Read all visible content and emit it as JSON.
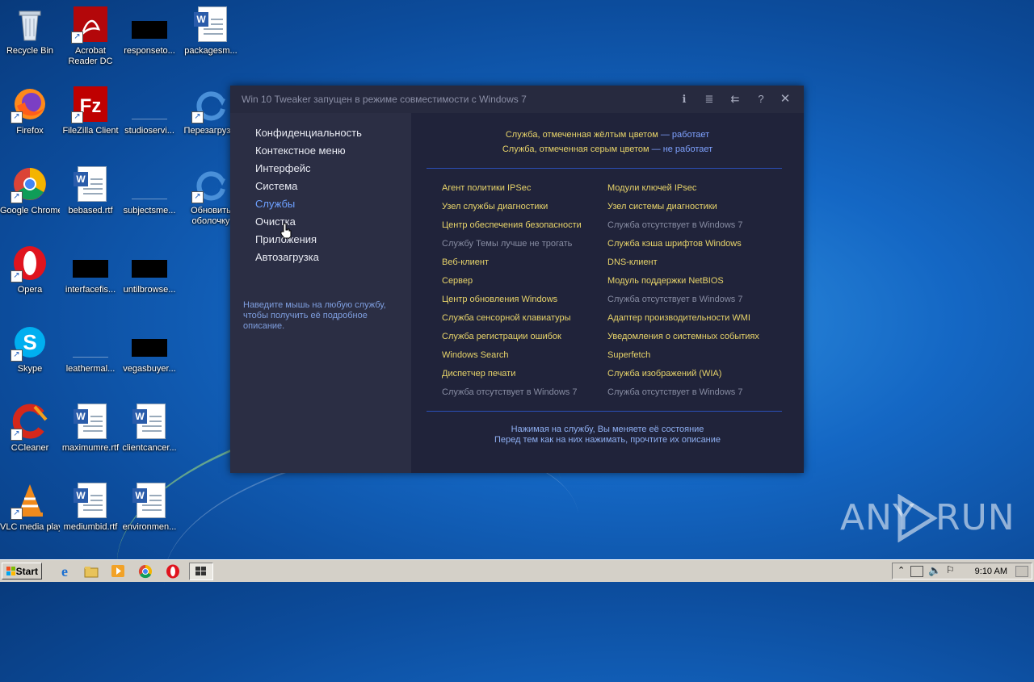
{
  "desktop": {
    "icons": [
      {
        "label": "Recycle Bin"
      },
      {
        "label": "Acrobat Reader DC"
      },
      {
        "label": "responseto..."
      },
      {
        "label": "packagesm..."
      },
      {
        "label": "Firefox"
      },
      {
        "label": "FileZilla Client"
      },
      {
        "label": "studioservi..."
      },
      {
        "label": "Перезагруз..."
      },
      {
        "label": "Google Chrome"
      },
      {
        "label": "bebased.rtf"
      },
      {
        "label": "subjectsme..."
      },
      {
        "label": "Обновить оболочку"
      },
      {
        "label": "Opera"
      },
      {
        "label": "interfacefis..."
      },
      {
        "label": "untilbrowse..."
      },
      {
        "label": "Skype"
      },
      {
        "label": "leathermal..."
      },
      {
        "label": "vegasbuyer..."
      },
      {
        "label": "CCleaner"
      },
      {
        "label": "maximumre.rtf"
      },
      {
        "label": "clientcancer..."
      },
      {
        "label": "VLC media player"
      },
      {
        "label": "mediumbid.rtf"
      },
      {
        "label": "environmen..."
      }
    ]
  },
  "app": {
    "title": "Win 10 Tweaker запущен в режиме совместимости с Windows 7",
    "title_buttons": [
      "info-icon",
      "list-icon",
      "menu-back-icon",
      "help-icon",
      "close-icon"
    ],
    "title_glyphs": {
      "info": "ℹ",
      "list": "≣",
      "menu": "⇇",
      "help": "?",
      "close": "✕"
    },
    "nav": [
      {
        "label": "Конфиденциальность"
      },
      {
        "label": "Контекстное меню"
      },
      {
        "label": "Интерфейс"
      },
      {
        "label": "Система"
      },
      {
        "label": "Службы",
        "active": true
      },
      {
        "label": "Очистка"
      },
      {
        "label": "Приложения"
      },
      {
        "label": "Автозагрузка"
      }
    ],
    "hint": "Наведите мышь на любую службу, чтобы получить её подробное описание.",
    "legend": {
      "yellow_text": "Служба, отмеченная жёлтым цветом",
      "yellow_dash": " — ",
      "yellow_status": "работает",
      "gray_text": "Служба, отмеченная серым цветом",
      "gray_dash": " — ",
      "gray_status": "не работает"
    },
    "services_left": [
      {
        "label": "Агент политики IPSec",
        "state": "y"
      },
      {
        "label": "Узел службы диагностики",
        "state": "y"
      },
      {
        "label": "Центр обеспечения безопасности",
        "state": "y"
      },
      {
        "label": "Службу Темы лучше не трогать",
        "state": "g"
      },
      {
        "label": "Веб-клиент",
        "state": "y"
      },
      {
        "label": "Сервер",
        "state": "y"
      },
      {
        "label": "Центр обновления Windows",
        "state": "y"
      },
      {
        "label": "Служба сенсорной клавиатуры",
        "state": "y"
      },
      {
        "label": "Служба регистрации ошибок",
        "state": "y"
      },
      {
        "label": "Windows Search",
        "state": "y"
      },
      {
        "label": "Диспетчер печати",
        "state": "y"
      },
      {
        "label": "Служба отсутствует в Windows 7",
        "state": "g"
      }
    ],
    "services_right": [
      {
        "label": "Модули ключей IPsec",
        "state": "y"
      },
      {
        "label": "Узел системы диагностики",
        "state": "y"
      },
      {
        "label": "Служба отсутствует в Windows 7",
        "state": "g"
      },
      {
        "label": "Служба кэша шрифтов Windows",
        "state": "y"
      },
      {
        "label": "DNS-клиент",
        "state": "y"
      },
      {
        "label": "Модуль поддержки NetBIOS",
        "state": "y"
      },
      {
        "label": "Служба отсутствует в Windows 7",
        "state": "g"
      },
      {
        "label": "Адаптер производительности WMI",
        "state": "y"
      },
      {
        "label": "Уведомления о системных событиях",
        "state": "y"
      },
      {
        "label": "Superfetch",
        "state": "y"
      },
      {
        "label": "Служба изображений (WIA)",
        "state": "y"
      },
      {
        "label": "Служба отсутствует в Windows 7",
        "state": "g"
      }
    ],
    "footer_line1": "Нажимая на службу, Вы меняете её состояние",
    "footer_line2": "Перед тем как на них нажимать, прочтите их описание",
    "colors": {
      "working": "#e8d46a",
      "stopped": "#878ca2",
      "accent": "#6da0ff"
    }
  },
  "taskbar": {
    "start_label": "Start",
    "clock": "9:10 AM",
    "pinned": [
      "ie-icon",
      "explorer-icon",
      "media-player-icon",
      "chrome-icon",
      "opera-icon",
      "app-window-icon"
    ]
  },
  "watermark": {
    "text_left": "ANY",
    "text_right": "RUN"
  }
}
